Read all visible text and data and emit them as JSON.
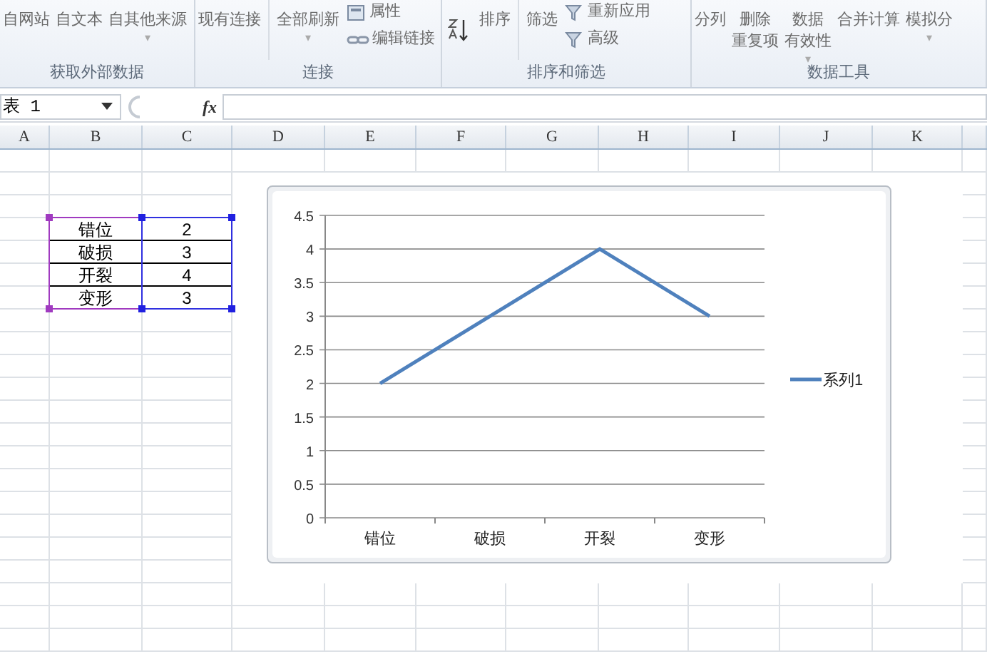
{
  "ribbon": {
    "groups": [
      {
        "label": "获取外部数据",
        "buttons": [
          {
            "kind": "large",
            "lines": [
              "自网站"
            ]
          },
          {
            "kind": "large",
            "lines": [
              "自文本"
            ]
          },
          {
            "kind": "large",
            "lines": [
              "自其他来源"
            ],
            "arrow": "▾"
          }
        ]
      },
      {
        "label": "连接",
        "buttons": [
          {
            "kind": "large",
            "lines": [
              "现有连接"
            ]
          },
          {
            "kind": "divider"
          },
          {
            "kind": "large",
            "lines": [
              "全部刷新"
            ],
            "arrow": "▾"
          },
          {
            "kind": "stack",
            "items": [
              {
                "label": "属性"
              },
              {
                "label": "编辑链接"
              }
            ]
          }
        ]
      },
      {
        "label": "排序和筛选",
        "buttons": [
          {
            "kind": "sorticon"
          },
          {
            "kind": "large",
            "lines": [
              "排序"
            ]
          },
          {
            "kind": "divider"
          },
          {
            "kind": "large",
            "lines": [
              "筛选"
            ]
          },
          {
            "kind": "stack",
            "items": [
              {
                "label": "重新应用"
              },
              {
                "label": "高级"
              }
            ]
          }
        ]
      },
      {
        "label": "数据工具",
        "buttons": [
          {
            "kind": "large",
            "lines": [
              "分列"
            ]
          },
          {
            "kind": "large",
            "lines": [
              "删除",
              "重复项"
            ]
          },
          {
            "kind": "large",
            "lines": [
              "数据",
              "有效性"
            ],
            "arrow": "▾"
          },
          {
            "kind": "large",
            "lines": [
              "合并计算"
            ]
          },
          {
            "kind": "large",
            "lines": [
              "模拟分"
            ],
            "arrow": "▾"
          }
        ]
      }
    ]
  },
  "formula_bar": {
    "name_box": "表 1",
    "fx": "fx"
  },
  "columns": [
    "A",
    "B",
    "C",
    "D",
    "E",
    "F",
    "G",
    "H",
    "I",
    "J",
    "K"
  ],
  "table": [
    {
      "label": "错位",
      "value": "2"
    },
    {
      "label": "破损",
      "value": "3"
    },
    {
      "label": "开裂",
      "value": "4"
    },
    {
      "label": "变形",
      "value": "3"
    }
  ],
  "chart_data": {
    "type": "line",
    "grid": true,
    "categories": [
      "错位",
      "破损",
      "开裂",
      "变形"
    ],
    "series": [
      {
        "name": "系列1",
        "color": "#4f81bd",
        "values": [
          2,
          3,
          4,
          3
        ]
      }
    ],
    "ylim": [
      0,
      4.5
    ],
    "yticks": [
      0,
      0.5,
      1,
      1.5,
      2,
      2.5,
      3,
      3.5,
      4,
      4.5
    ]
  }
}
